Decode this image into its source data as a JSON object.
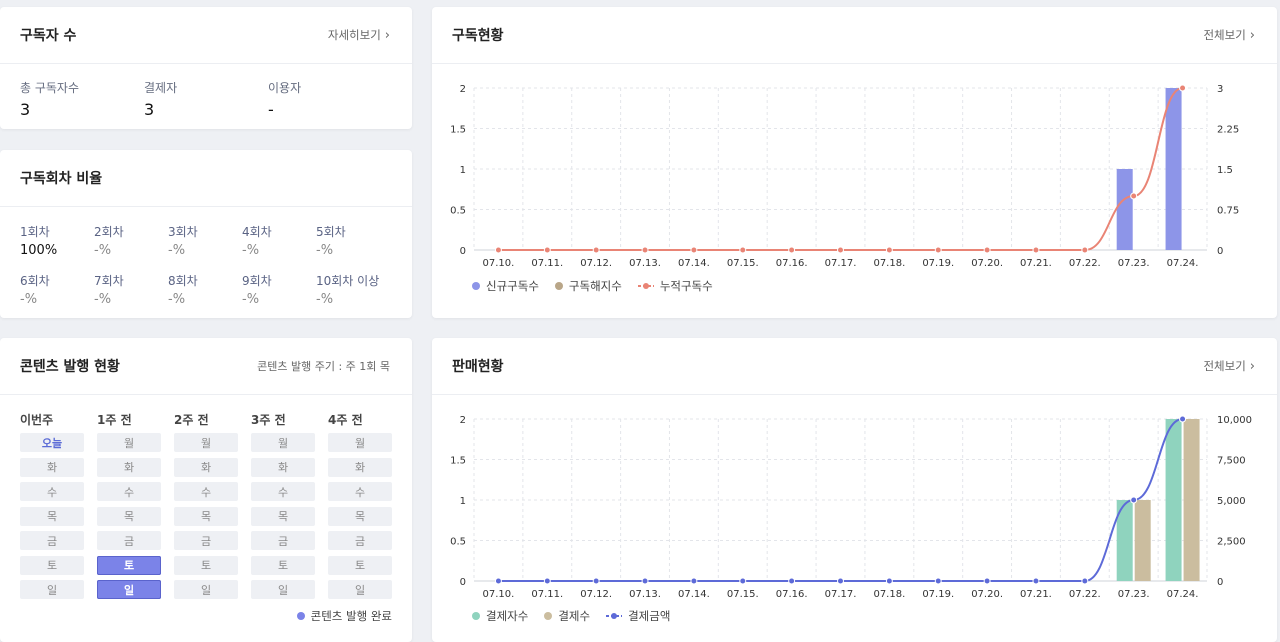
{
  "subscribers": {
    "title": "구독자 수",
    "link": "자세히보기",
    "stats": [
      {
        "label": "총 구독자수",
        "value": "3"
      },
      {
        "label": "결제자",
        "value": "3"
      },
      {
        "label": "이용자",
        "value": "-"
      }
    ]
  },
  "ratio": {
    "title": "구독회차 비율",
    "items": [
      {
        "label": "1회차",
        "value": "100%"
      },
      {
        "label": "2회차",
        "value": "-%"
      },
      {
        "label": "3회차",
        "value": "-%"
      },
      {
        "label": "4회차",
        "value": "-%"
      },
      {
        "label": "5회차",
        "value": "-%"
      },
      {
        "label": "6회차",
        "value": "-%"
      },
      {
        "label": "7회차",
        "value": "-%"
      },
      {
        "label": "8회차",
        "value": "-%"
      },
      {
        "label": "9회차",
        "value": "-%"
      },
      {
        "label": "10회차 이상",
        "value": "-%"
      }
    ]
  },
  "publish": {
    "title": "콘텐츠 발행 현황",
    "note": "콘텐츠 발행 주기 : 주 1회 목",
    "legend": "콘텐츠 발행 완료",
    "done_color": "#7b83e8",
    "weeks": [
      {
        "label": "이번주",
        "days": [
          "오늘",
          "화",
          "수",
          "목",
          "금",
          "토",
          "일"
        ],
        "done": [],
        "today": 0
      },
      {
        "label": "1주 전",
        "days": [
          "월",
          "화",
          "수",
          "목",
          "금",
          "토",
          "일"
        ],
        "done": [
          5,
          6
        ],
        "today": -1
      },
      {
        "label": "2주 전",
        "days": [
          "월",
          "화",
          "수",
          "목",
          "금",
          "토",
          "일"
        ],
        "done": [],
        "today": -1
      },
      {
        "label": "3주 전",
        "days": [
          "월",
          "화",
          "수",
          "목",
          "금",
          "토",
          "일"
        ],
        "done": [],
        "today": -1
      },
      {
        "label": "4주 전",
        "days": [
          "월",
          "화",
          "수",
          "목",
          "금",
          "토",
          "일"
        ],
        "done": [],
        "today": -1
      }
    ]
  },
  "sub_chart": {
    "title": "구독현황",
    "link": "전체보기"
  },
  "sales_chart": {
    "title": "판매현황",
    "link": "전체보기"
  },
  "chart_data": [
    {
      "type": "bar",
      "categories": [
        "07.10.",
        "07.11.",
        "07.12.",
        "07.13.",
        "07.14.",
        "07.15.",
        "07.16.",
        "07.17.",
        "07.18.",
        "07.19.",
        "07.20.",
        "07.21.",
        "07.22.",
        "07.23.",
        "07.24."
      ],
      "series": [
        {
          "name": "신규구독수",
          "type": "bar",
          "axis": "left",
          "color": "#8d95e8",
          "values": [
            0,
            0,
            0,
            0,
            0,
            0,
            0,
            0,
            0,
            0,
            0,
            0,
            0,
            1,
            2
          ]
        },
        {
          "name": "구독해지수",
          "type": "bar",
          "axis": "left",
          "color": "#b9a688",
          "values": [
            0,
            0,
            0,
            0,
            0,
            0,
            0,
            0,
            0,
            0,
            0,
            0,
            0,
            0,
            0
          ]
        },
        {
          "name": "누적구독수",
          "type": "line",
          "axis": "right",
          "color": "#e98475",
          "values": [
            0,
            0,
            0,
            0,
            0,
            0,
            0,
            0,
            0,
            0,
            0,
            0,
            0,
            1,
            3
          ]
        }
      ],
      "yticks_left": [
        "0",
        "0.5",
        "1",
        "1.5",
        "2"
      ],
      "ylim_left": [
        0,
        2
      ],
      "yticks_right": [
        "0",
        "0.75",
        "1.5",
        "2.25",
        "3"
      ],
      "ylim_right": [
        0,
        3
      ],
      "grid": true,
      "legend": "bottom-left"
    },
    {
      "type": "bar",
      "categories": [
        "07.10.",
        "07.11.",
        "07.12.",
        "07.13.",
        "07.14.",
        "07.15.",
        "07.16.",
        "07.17.",
        "07.18.",
        "07.19.",
        "07.20.",
        "07.21.",
        "07.22.",
        "07.23.",
        "07.24."
      ],
      "series": [
        {
          "name": "결제자수",
          "type": "bar",
          "axis": "left",
          "color": "#8fd3be",
          "values": [
            0,
            0,
            0,
            0,
            0,
            0,
            0,
            0,
            0,
            0,
            0,
            0,
            0,
            1,
            2
          ]
        },
        {
          "name": "결제수",
          "type": "bar",
          "axis": "left",
          "color": "#cbbd9f",
          "values": [
            0,
            0,
            0,
            0,
            0,
            0,
            0,
            0,
            0,
            0,
            0,
            0,
            0,
            1,
            2
          ]
        },
        {
          "name": "결제금액",
          "type": "line",
          "axis": "right",
          "color": "#5d6ad8",
          "values": [
            0,
            0,
            0,
            0,
            0,
            0,
            0,
            0,
            0,
            0,
            0,
            0,
            0,
            5000,
            10000
          ]
        }
      ],
      "yticks_left": [
        "0",
        "0.5",
        "1",
        "1.5",
        "2"
      ],
      "ylim_left": [
        0,
        2
      ],
      "yticks_right": [
        "0",
        "2,500",
        "5,000",
        "7,500",
        "10,000"
      ],
      "ylim_right": [
        0,
        10000
      ],
      "grid": true,
      "legend": "bottom-left"
    }
  ]
}
